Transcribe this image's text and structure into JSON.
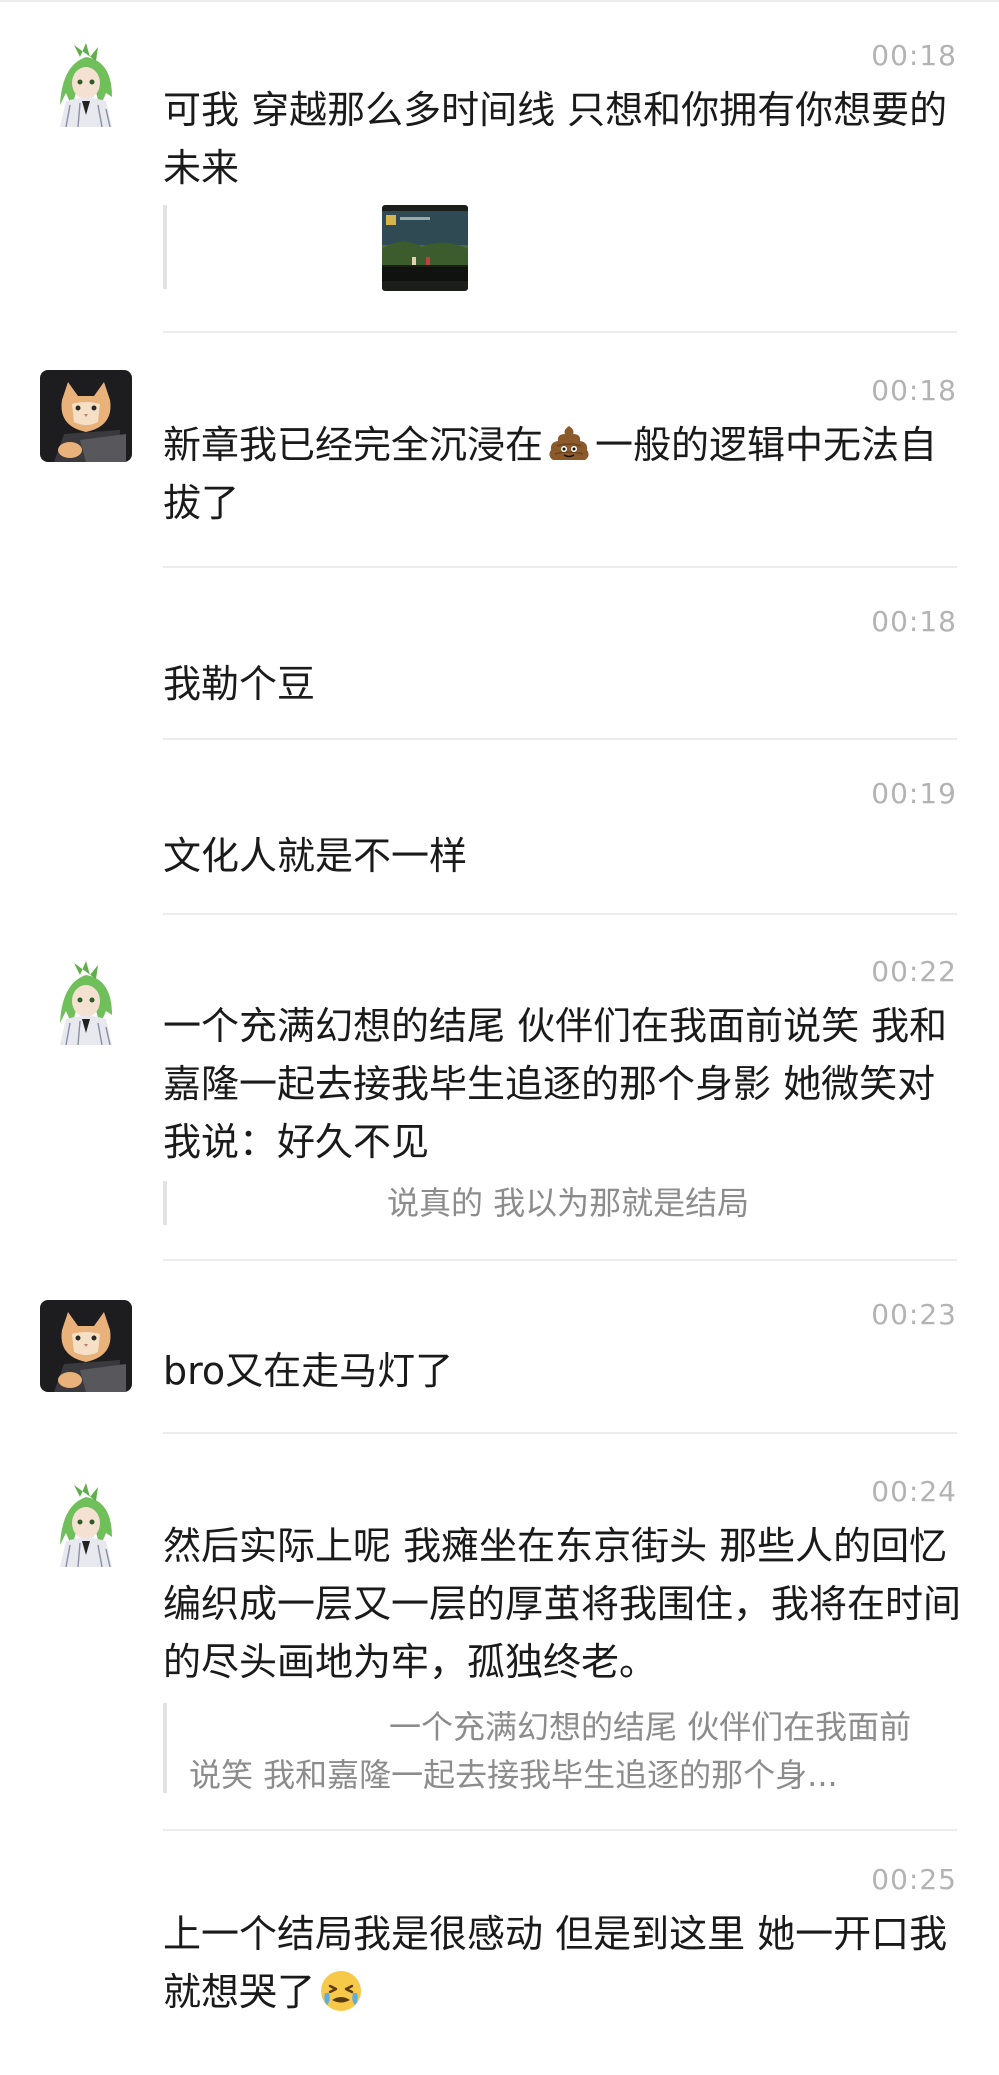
{
  "messages": [
    {
      "time": "00:18",
      "avatar": "anime-green-hair-avatar",
      "text": "可我 穿越那么多时间线  只想和你拥有你想要的未来",
      "attachment": "image-thumbnail"
    },
    {
      "time": "00:18",
      "avatar": "cat-laptop-avatar",
      "text_before": "新章我已经完全沉浸在",
      "emoji": "poop-emoji",
      "text_after": "一般的逻辑中无法自拔了"
    },
    {
      "time": "00:18",
      "text": "我勒个豆"
    },
    {
      "time": "00:19",
      "text": "文化人就是不一样"
    },
    {
      "time": "00:22",
      "avatar": "anime-green-hair-avatar",
      "text": "一个充满幻想的结尾 伙伴们在我面前说笑 我和嘉隆一起去接我毕生追逐的那个身影 她微笑对我说：好久不见",
      "quote": "说真的 我以为那就是结局"
    },
    {
      "time": "00:23",
      "avatar": "cat-laptop-avatar",
      "text": "bro又在走马灯了"
    },
    {
      "time": "00:24",
      "avatar": "anime-green-hair-avatar",
      "text": "然后实际上呢 我瘫坐在东京街头 那些人的回忆编织成一层又一层的厚茧将我围住，我将在时间的尽头画地为牢，孤独终老。",
      "quote": "一个充满幻想的结尾 伙伴们在我面前说笑 我和嘉隆一起去接我毕生追逐的那个身..."
    },
    {
      "time": "00:25",
      "text": "上一个结局我是很感动 但是到这里  她一开口我就想哭了",
      "emoji": "crying-face-emoji"
    }
  ]
}
